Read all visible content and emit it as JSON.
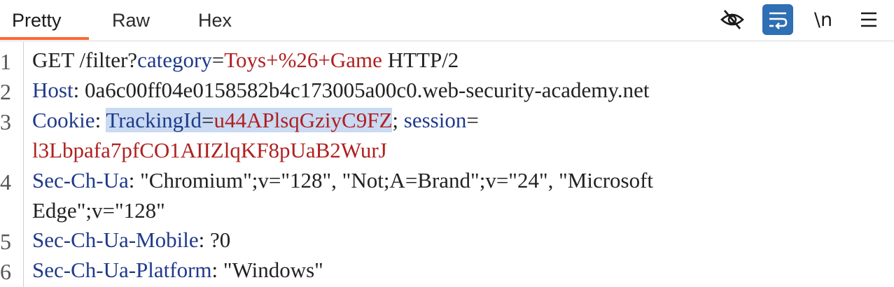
{
  "tabs": [
    "Pretty",
    "Raw",
    "Hex"
  ],
  "toolbar": {
    "newline_label": "\\n",
    "icons": [
      "eye-slash-icon",
      "wrap-lines-icon",
      "newline-icon",
      "menu-icon"
    ],
    "active_color": "#2f6fb3",
    "tab_underline_color": "#ff6633"
  },
  "editor": {
    "line_numbers": [
      "1",
      "2",
      "3",
      "4",
      "5",
      "6"
    ],
    "l1": {
      "method": "GET /filter?",
      "param": "category",
      "eq": "=",
      "value": "Toys+%26+Game",
      "proto": " HTTP/2"
    },
    "l2": {
      "name": "Host",
      "sep": ": ",
      "value": "0a6c00ff04e0158582b4c173005a00c0.web-security-academy.net"
    },
    "l3": {
      "name": "Cookie",
      "sep": ": ",
      "c1name": "TrackingId",
      "c1eq": "=",
      "c1val": "u44APlsqGziyC9FZ",
      "semi": "; ",
      "c2name": "session",
      "c2eq": "=",
      "c2val": "l3Lbpafa7pfCO1AIIZlqKF8pUaB2WurJ"
    },
    "l4": {
      "name": "Sec-Ch-Ua",
      "sep": ": ",
      "value1": "\"Chromium\";v=\"128\", \"Not;A=Brand\";v=\"24\", \"Microsoft",
      "value2": "Edge\";v=\"128\""
    },
    "l5": {
      "name": "Sec-Ch-Ua-Mobile",
      "sep": ": ",
      "value": "?0"
    },
    "l6": {
      "name": "Sec-Ch-Ua-Platform",
      "sep": ": ",
      "value": "\"Windows\""
    }
  }
}
